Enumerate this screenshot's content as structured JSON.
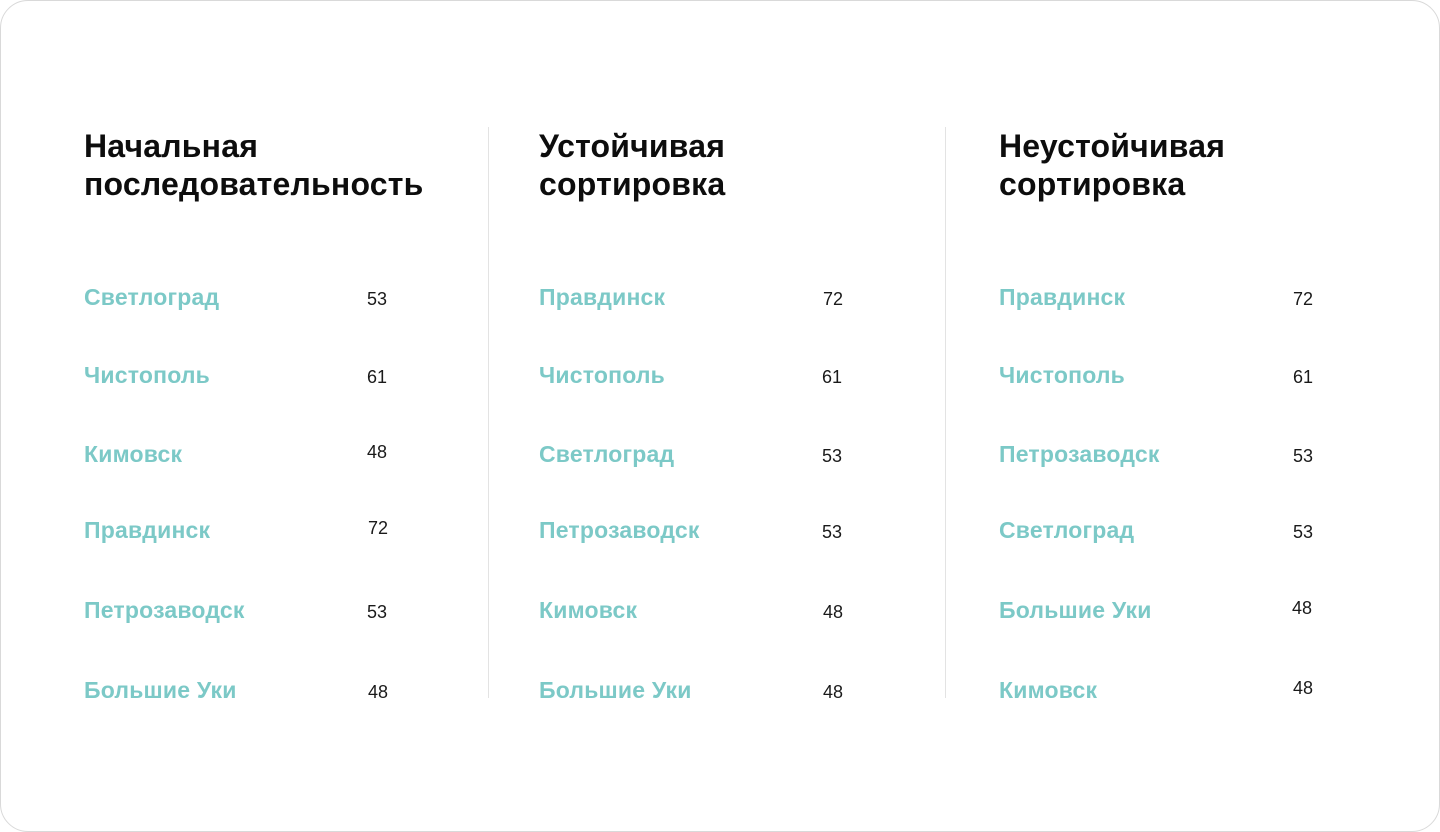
{
  "columns": [
    {
      "title_lines": [
        "Начальная",
        "последовательность"
      ],
      "rows": [
        {
          "name": "Светлоград",
          "value": "53"
        },
        {
          "name": "Чистополь",
          "value": "61"
        },
        {
          "name": "Кимовск",
          "value": "48"
        },
        {
          "name": "Правдинск",
          "value": "72"
        },
        {
          "name": "Петрозаводск",
          "value": "53"
        },
        {
          "name": "Большие Уки",
          "value": "48"
        }
      ]
    },
    {
      "title_lines": [
        "Устойчивая",
        "сортировка"
      ],
      "rows": [
        {
          "name": "Правдинск",
          "value": "72"
        },
        {
          "name": "Чистополь",
          "value": "61"
        },
        {
          "name": "Светлоград",
          "value": "53"
        },
        {
          "name": "Петрозаводск",
          "value": "53"
        },
        {
          "name": "Кимовск",
          "value": "48"
        },
        {
          "name": "Большие Уки",
          "value": "48"
        }
      ]
    },
    {
      "title_lines": [
        "Неустойчивая",
        "сортировка"
      ],
      "rows": [
        {
          "name": "Правдинск",
          "value": "72"
        },
        {
          "name": "Чистополь",
          "value": "61"
        },
        {
          "name": "Петрозаводск",
          "value": "53"
        },
        {
          "name": "Светлоград",
          "value": "53"
        },
        {
          "name": "Большие Уки",
          "value": "48"
        },
        {
          "name": "Кимовск",
          "value": "48"
        }
      ]
    }
  ],
  "colors": {
    "city_name": "#7cc9c7",
    "title": "#0d0d0d",
    "value": "#1a1a1a",
    "divider": "#e3e3e3"
  }
}
